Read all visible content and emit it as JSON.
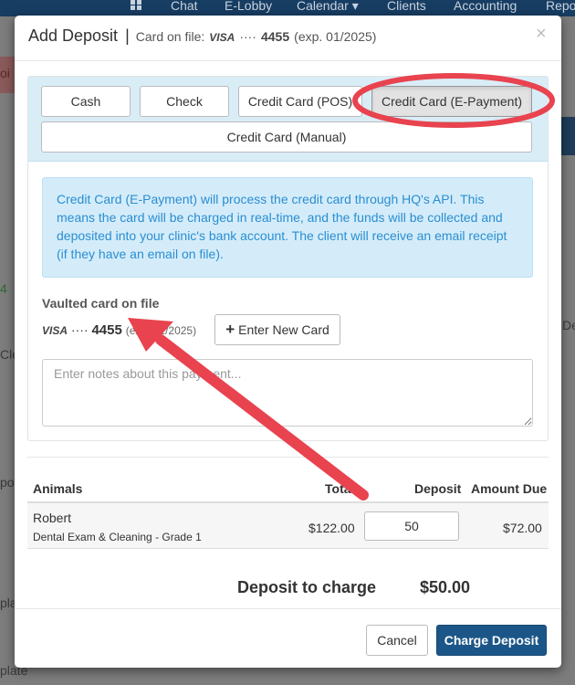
{
  "topnav": {
    "items": [
      "Chat",
      "E-Lobby",
      "Calendar ▾",
      "Clients",
      "Accounting",
      "Repo"
    ]
  },
  "background": {
    "fragments": [
      "oi",
      "4",
      "Cle",
      "De",
      "po",
      "plat",
      "plate"
    ]
  },
  "modal": {
    "title": "Add Deposit",
    "separator": "|",
    "card_on_file_label": "Card on file:",
    "card_brand": "VISA",
    "card_dots": "····",
    "card_last4": "4455",
    "card_exp": "(exp. 01/2025)",
    "close_label": "×"
  },
  "payment_methods": [
    {
      "label": "Cash",
      "active": false
    },
    {
      "label": "Check",
      "active": false
    },
    {
      "label": "Credit Card (POS)",
      "active": false
    },
    {
      "label": "Credit Card (E-Payment)",
      "active": true
    },
    {
      "label": "Credit Card (Manual)",
      "active": false
    }
  ],
  "info_text": "Credit Card (E-Payment) will process the credit card through HQ's API. This means the card will be charged in real-time, and the funds will be collected and deposited into your clinic's bank account. The client will receive an email receipt (if they have an email on file).",
  "vault": {
    "label": "Vaulted card on file",
    "brand": "VISA",
    "dots": "····",
    "last4": "4455",
    "exp": "(exp. 01/2025)",
    "new_card_label": "Enter New Card"
  },
  "notes": {
    "placeholder": "Enter notes about this payment..."
  },
  "table": {
    "headers": {
      "animals": "Animals",
      "total": "Total",
      "deposit": "Deposit",
      "amount_due": "Amount Due"
    },
    "rows": [
      {
        "animal": "Robert",
        "service": "Dental Exam & Cleaning - Grade 1",
        "total": "$122.00",
        "deposit": "50",
        "amount_due": "$72.00"
      }
    ]
  },
  "summary": {
    "label": "Deposit to charge",
    "amount": "$50.00"
  },
  "footer": {
    "cancel_label": "Cancel",
    "charge_label": "Charge Deposit"
  },
  "colors": {
    "primary": "#1c5688",
    "info_bg": "#d4ecfa",
    "info_text": "#2a8ed0",
    "method_bar_bg": "#d9edf7",
    "annotation_red": "#e8434f"
  }
}
